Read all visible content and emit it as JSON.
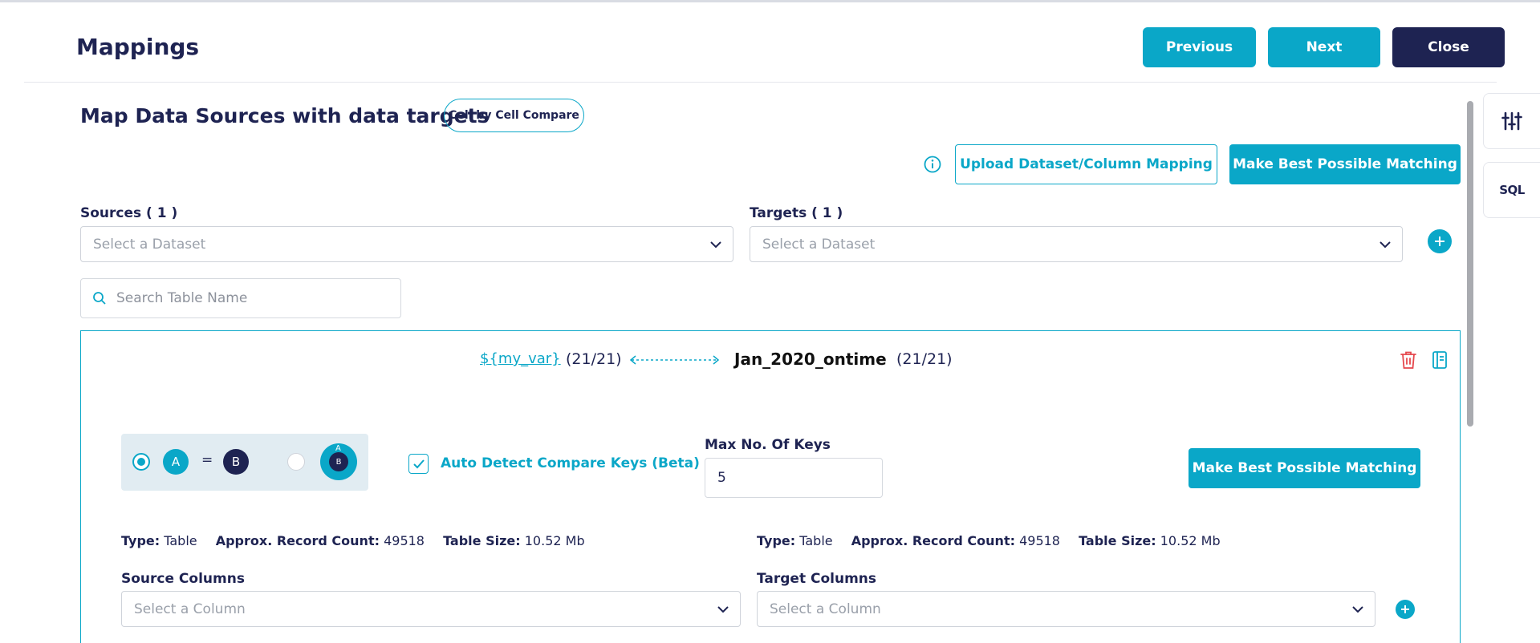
{
  "header": {
    "title": "Mappings",
    "previous_label": "Previous",
    "next_label": "Next",
    "close_label": "Close"
  },
  "side_tools": {
    "sql_label": "SQL"
  },
  "section": {
    "title": "Map Data Sources with data targets",
    "compare_badge": "Cell by Cell Compare",
    "upload_label": "Upload Dataset/Column Mapping",
    "best_match_label": "Make Best Possible Matching"
  },
  "sources": {
    "label": "Sources ( 1 )",
    "placeholder": "Select a Dataset"
  },
  "targets": {
    "label": "Targets ( 1 )",
    "placeholder": "Select a Dataset"
  },
  "search": {
    "placeholder": "Search Table Name"
  },
  "mapping": {
    "source_name": "${my_var}",
    "source_count": "(21/21)",
    "target_name": "Jan_2020_ontime",
    "target_count": "(21/21)",
    "mode_a": "A",
    "mode_b": "B",
    "mode_eq": "=",
    "auto_detect_label": "Auto Detect Compare Keys (Beta)",
    "auto_detect_checked": true,
    "max_keys_label": "Max No. Of Keys",
    "max_keys_value": "5",
    "best_match_label": "Make Best Possible Matching",
    "source_meta": {
      "type_key": "Type:",
      "type_val": "Table",
      "count_key": "Approx. Record Count:",
      "count_val": "49518",
      "size_key": "Table Size:",
      "size_val": "10.52 Mb"
    },
    "target_meta": {
      "type_key": "Type:",
      "type_val": "Table",
      "count_key": "Approx. Record Count:",
      "count_val": "49518",
      "size_key": "Table Size:",
      "size_val": "10.52 Mb"
    },
    "source_columns_label": "Source Columns",
    "source_columns_placeholder": "Select a Column",
    "target_columns_label": "Target Columns",
    "target_columns_placeholder": "Select a Column"
  },
  "colors": {
    "accent": "#0aa7c8",
    "navy": "#1e2352",
    "danger": "#e5484d"
  },
  "icons": [
    "settings-sliders-icon",
    "info-icon",
    "chevron-down-icon",
    "plus-icon",
    "search-icon",
    "bidirectional-arrow-icon",
    "trash-icon",
    "notebook-icon",
    "checkmark-icon"
  ]
}
